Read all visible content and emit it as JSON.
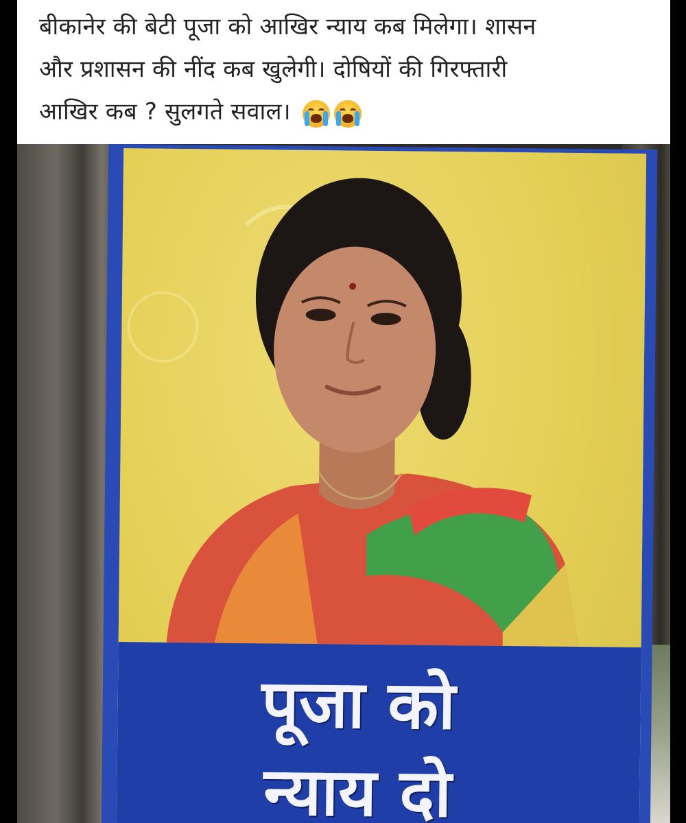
{
  "post": {
    "caption_line1": "बीकानेर की बेटी पूजा को आखिर न्याय कब मिलेगा। शासन",
    "caption_line2": "और प्रशासन की नींद कब खुलेगी। दोषियों की गिरफ्तारी",
    "caption_line3": "आखिर कब ? सुलगते सवाल।",
    "emoji_icon": "crying-face-icon",
    "emoji_count": 2
  },
  "poster": {
    "banner_line1": "पूजा को",
    "banner_line2": "न्याय दो",
    "colors": {
      "frame_blue": "#2a4bb6",
      "banner_blue": "#1f3ea8",
      "background_yellow": "#e8d35a",
      "text_white": "#f4f4ff"
    }
  }
}
